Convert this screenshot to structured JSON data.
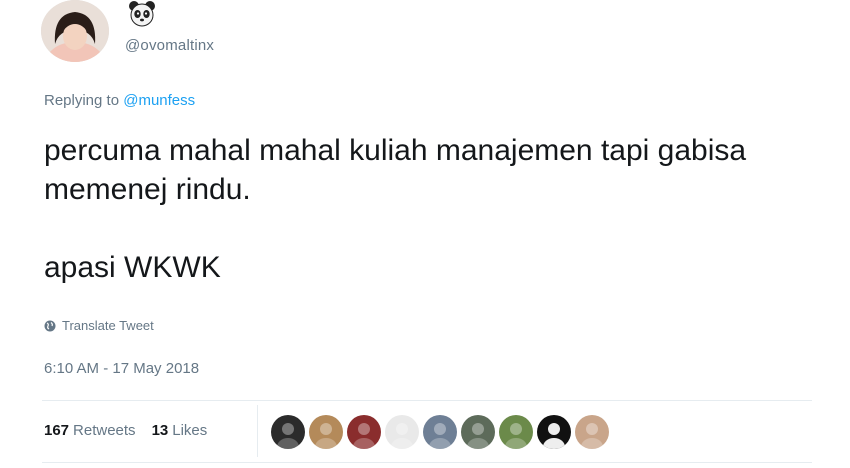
{
  "user": {
    "handle": "@ovomaltinx",
    "name_emoji_icon": "panda-face-icon",
    "avatar_icon": "profile-photo"
  },
  "reply": {
    "prefix": "Replying to",
    "mention": "@munfess"
  },
  "tweet": {
    "line1": "percuma mahal mahal kuliah manajemen tapi gabisa memenej rindu.",
    "line2": "apasi WKWK"
  },
  "translate": {
    "label": "Translate Tweet",
    "icon": "globe-icon"
  },
  "timestamp": "6:10 AM - 17 May 2018",
  "stats": {
    "retweets_count": "167",
    "retweets_label": "Retweets",
    "likes_count": "13",
    "likes_label": "Likes"
  },
  "likers": [
    {
      "name": "liker-avatar-1",
      "color": "#2b2b2b"
    },
    {
      "name": "liker-avatar-2",
      "color": "#b48a5a"
    },
    {
      "name": "liker-avatar-3",
      "color": "#8a2d2d"
    },
    {
      "name": "liker-avatar-4",
      "color": "#e9e9e9"
    },
    {
      "name": "liker-avatar-5",
      "color": "#6e7f95"
    },
    {
      "name": "liker-avatar-6",
      "color": "#5d6b5a"
    },
    {
      "name": "liker-avatar-7",
      "color": "#6b8a4a"
    },
    {
      "name": "liker-avatar-8",
      "color": "#111111"
    },
    {
      "name": "liker-avatar-9",
      "color": "#c9a58a"
    }
  ],
  "colors": {
    "text": "#14171a",
    "secondary": "#657786",
    "link": "#1da1f2",
    "divider": "#e6ecf0"
  }
}
